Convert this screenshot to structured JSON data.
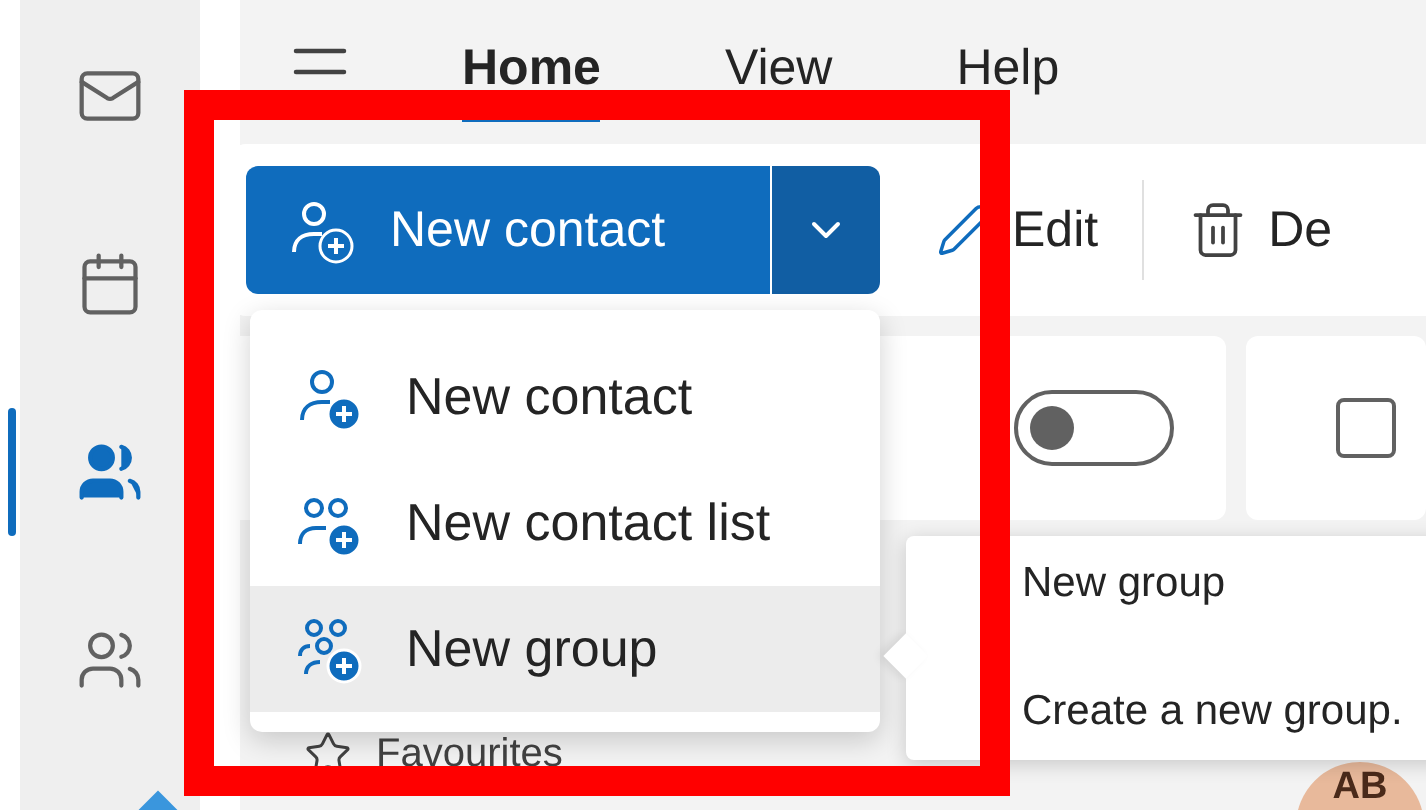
{
  "rail": [
    {
      "kind": "mail",
      "selected": false
    },
    {
      "kind": "calendar",
      "selected": false
    },
    {
      "kind": "people",
      "selected": true
    },
    {
      "kind": "groups",
      "selected": false
    }
  ],
  "tabs": [
    {
      "label": "Home",
      "selected": true
    },
    {
      "label": "View",
      "selected": false
    },
    {
      "label": "Help",
      "selected": false
    }
  ],
  "toolbar": {
    "primary": "New contact",
    "buttons": [
      {
        "kind": "edit",
        "label": "Edit"
      },
      {
        "kind": "delete",
        "label": "De"
      }
    ]
  },
  "toggle": {
    "on": false
  },
  "checkbox": {
    "checked": false
  },
  "menu": [
    {
      "kind": "contact",
      "label": "New contact",
      "hovered": false
    },
    {
      "kind": "list",
      "label": "New contact list",
      "hovered": false
    },
    {
      "kind": "group",
      "label": "New group",
      "hovered": true
    }
  ],
  "tooltip": {
    "title": "New group",
    "text": "Create a new group."
  },
  "favourites": "Favourites",
  "avatar": "AB"
}
